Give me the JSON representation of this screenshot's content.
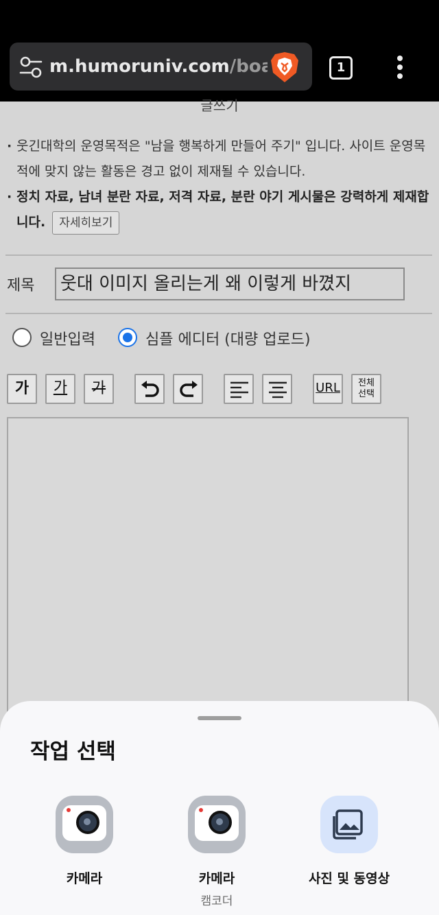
{
  "browser": {
    "url_host": "m.humoruniv.com",
    "url_rest": "/board",
    "tab_count": "1"
  },
  "page": {
    "cut_title": "글쓰기",
    "notice_line1": "웃긴대학의 운영목적은 \"남을 행복하게 만들어 주기\" 입니다. 사이트 운영목적에 맞지 않는 활동은 경고 없이 제재될 수 있습니다.",
    "notice_line2": "정치 자료, 남녀 분란 자료, 저격 자료, 분란 야기 게시물은 강력하게 제재합니다.",
    "more_button": "자세히보기",
    "title_label": "제목",
    "title_value": "웃대 이미지 올리는게 왜 이렇게 바꼈지",
    "radio_normal": "일반입력",
    "radio_simple": "심플 에디터 (대량 업로드)",
    "selected_radio": "simple"
  },
  "editor_toolbar": {
    "bold_label": "가",
    "underline_label": "가",
    "strike_label": "가",
    "url_label": "URL",
    "select_all_label_1": "전체",
    "select_all_label_2": "선택"
  },
  "sheet": {
    "title": "작업 선택",
    "apps": [
      {
        "label": "카메라",
        "sub": "",
        "icon": "camera-icon"
      },
      {
        "label": "카메라",
        "sub": "캠코더",
        "icon": "camcorder-icon"
      },
      {
        "label": "사진 및 동영상",
        "sub": "",
        "icon": "gallery-icon"
      }
    ]
  },
  "colors": {
    "accent": "#1a73e8",
    "brave": "#f05a24"
  }
}
